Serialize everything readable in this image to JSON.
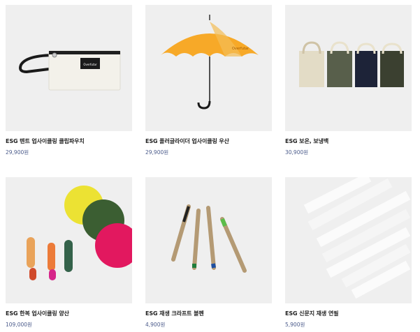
{
  "products": [
    {
      "title": "ESG 텐트 업사이클링 클립파우치",
      "price": "29,900원",
      "image": "pouch-image"
    },
    {
      "title": "ESG 폴러글라이더 업사이클링 우산",
      "price": "29,900원",
      "image": "umbrella-image"
    },
    {
      "title": "ESG 보온, 보냉백",
      "price": "30,900원",
      "image": "cooler-bags-image"
    },
    {
      "title": "ESG 한복 업사이클링 양산",
      "price": "109,000원",
      "image": "parasols-image"
    },
    {
      "title": "ESG 재생 크라프트 볼펜",
      "price": "4,900원",
      "image": "kraft-pens-image"
    },
    {
      "title": "ESG 신문지 재생 연필",
      "price": "5,900원",
      "image": "newspaper-pencils-image"
    }
  ],
  "pouch_label": "Overfutar",
  "umbrella_label": "Overfutar"
}
